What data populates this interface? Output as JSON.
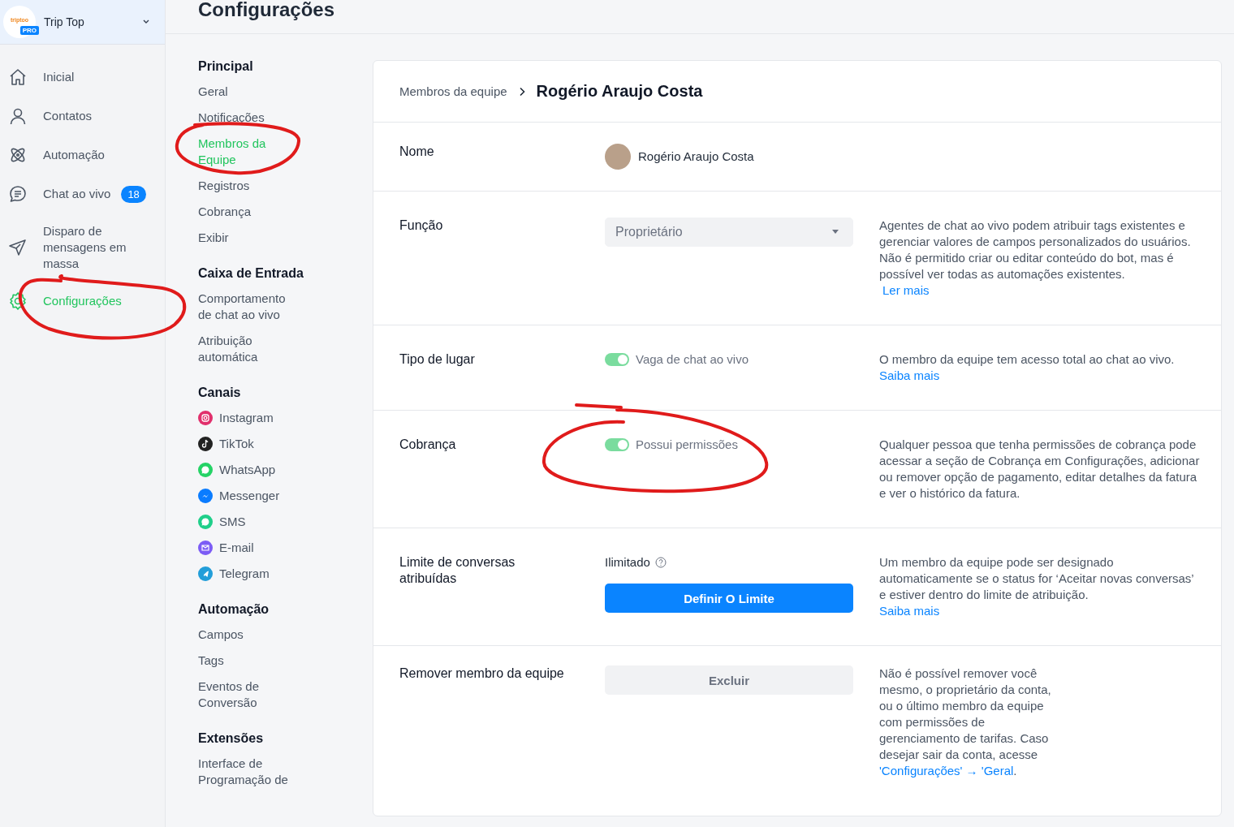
{
  "workspace": {
    "logo_text": "triptoo",
    "plan": "PRO",
    "name": "Trip Top"
  },
  "nav": [
    {
      "label": "Inicial",
      "kind": "home",
      "selected": false
    },
    {
      "label": "Contatos",
      "kind": "user",
      "selected": false
    },
    {
      "label": "Automação",
      "kind": "atom",
      "selected": false
    },
    {
      "label": "Chat ao vivo",
      "kind": "chat",
      "selected": false,
      "badge": "18"
    },
    {
      "label": "Disparo de mensagens em massa",
      "kind": "send",
      "selected": false
    },
    {
      "label": "Configurações",
      "kind": "gear",
      "selected": true
    }
  ],
  "page_title": "Configurações",
  "settings_nav": [
    {
      "heading": "Principal",
      "items": [
        {
          "label": "Geral",
          "selected": false
        },
        {
          "label": "Notificações",
          "selected": false
        },
        {
          "label": "Membros da Equipe",
          "selected": true
        },
        {
          "label": "Registros",
          "selected": false
        },
        {
          "label": "Cobrança",
          "selected": false
        },
        {
          "label": "Exibir",
          "selected": false
        }
      ]
    },
    {
      "heading": "Caixa de Entrada",
      "items": [
        {
          "label": "Comportamento de chat ao vivo",
          "selected": false
        },
        {
          "label": "Atribuição automática",
          "selected": false
        }
      ]
    },
    {
      "heading": "Canais",
      "items": [
        {
          "label": "Instagram",
          "selected": false,
          "kind": "instagram"
        },
        {
          "label": "TikTok",
          "selected": false,
          "kind": "tiktok"
        },
        {
          "label": "WhatsApp",
          "selected": false,
          "kind": "whatsapp"
        },
        {
          "label": "Messenger",
          "selected": false,
          "kind": "messenger"
        },
        {
          "label": "SMS",
          "selected": false,
          "kind": "sms"
        },
        {
          "label": "E-mail",
          "selected": false,
          "kind": "email"
        },
        {
          "label": "Telegram",
          "selected": false,
          "kind": "telegram"
        }
      ]
    },
    {
      "heading": "Automação",
      "items": [
        {
          "label": "Campos",
          "selected": false
        },
        {
          "label": "Tags",
          "selected": false
        },
        {
          "label": "Eventos de Conversão",
          "selected": false
        }
      ]
    },
    {
      "heading": "Extensões",
      "items": [
        {
          "label": "Interface de Programação de",
          "selected": false
        }
      ]
    }
  ],
  "breadcrumb": {
    "parent": "Membros da equipe",
    "current": "Rogério Araujo Costa"
  },
  "rows": [
    {
      "kind": "name",
      "label": "Nome",
      "value": "Rogério Araujo Costa"
    },
    {
      "kind": "select",
      "label": "Função",
      "value": "Proprietário",
      "disabled": true,
      "description": "Agentes de chat ao vivo podem atribuir tags existentes e gerenciar valores de campos personalizados do usuários. Não é permitido criar ou editar conteúdo do bot, mas é possível ver todas as automações existentes.",
      "link": "Ler mais"
    },
    {
      "kind": "toggle",
      "label": "Tipo de lugar",
      "toggle_label": "Vaga de chat ao vivo",
      "on": true,
      "disabled": true,
      "description": "O membro da equipe tem acesso total ao chat ao vivo.",
      "link": "Saiba mais"
    },
    {
      "kind": "toggle",
      "label": "Cobrança",
      "toggle_label": "Possui permissões",
      "on": true,
      "disabled": true,
      "description": "Qualquer pessoa que tenha permissões de cobrança pode acessar a seção de Cobrança em Configurações, adicionar ou remover opção de pagamento, editar detalhes da fatura e ver o histórico da fatura."
    },
    {
      "kind": "limit",
      "label": "Limite de conversas atribuídas",
      "value": "Ilimitado",
      "button": "Definir O Limite",
      "description": "Um membro da equipe pode ser designado automaticamente se o status for ‘Aceitar novas conversas’ e estiver dentro do limite de atribuição.",
      "link": "Saiba mais"
    },
    {
      "kind": "remove",
      "label": "Remover membro da equipe",
      "button": "Excluir",
      "disabled": true,
      "description": "Não é possível remover você mesmo, o proprietário da conta, ou o último membro da equipe com permissões de gerenciamento de tarifas. Caso desejar sair da conta, acesse",
      "link": "'Configurações' → 'Geral",
      "link_suffix": "."
    }
  ]
}
